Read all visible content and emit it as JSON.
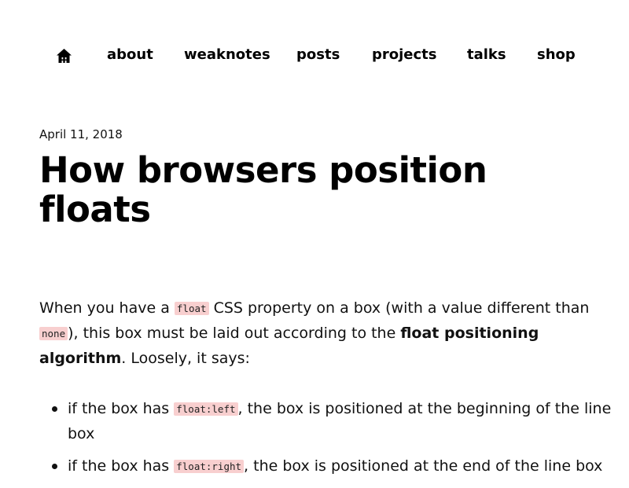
{
  "nav": {
    "home_icon": "home-icon",
    "items": [
      {
        "label": "about"
      },
      {
        "label": "weaknotes"
      },
      {
        "label": "posts"
      },
      {
        "label": "projects"
      },
      {
        "label": "talks"
      },
      {
        "label": "shop"
      }
    ]
  },
  "post": {
    "date": "April 11, 2018",
    "title": "How browsers position floats",
    "intro": {
      "t1": "When you have a ",
      "code1": "float",
      "t2": " CSS property on a box (with a value different than ",
      "code2": "none",
      "t3": "), this box must be laid out according to the ",
      "bold": "float positioning algorithm",
      "t4": ". Loosely, it says:"
    },
    "bullets": [
      {
        "t1": "if the box has ",
        "code": "float:left",
        "t2": ", the box is positioned at the beginning of the line box"
      },
      {
        "t1": "if the box has ",
        "code": "float:right",
        "t2": ", the box is positioned at the end of the line box"
      }
    ]
  }
}
